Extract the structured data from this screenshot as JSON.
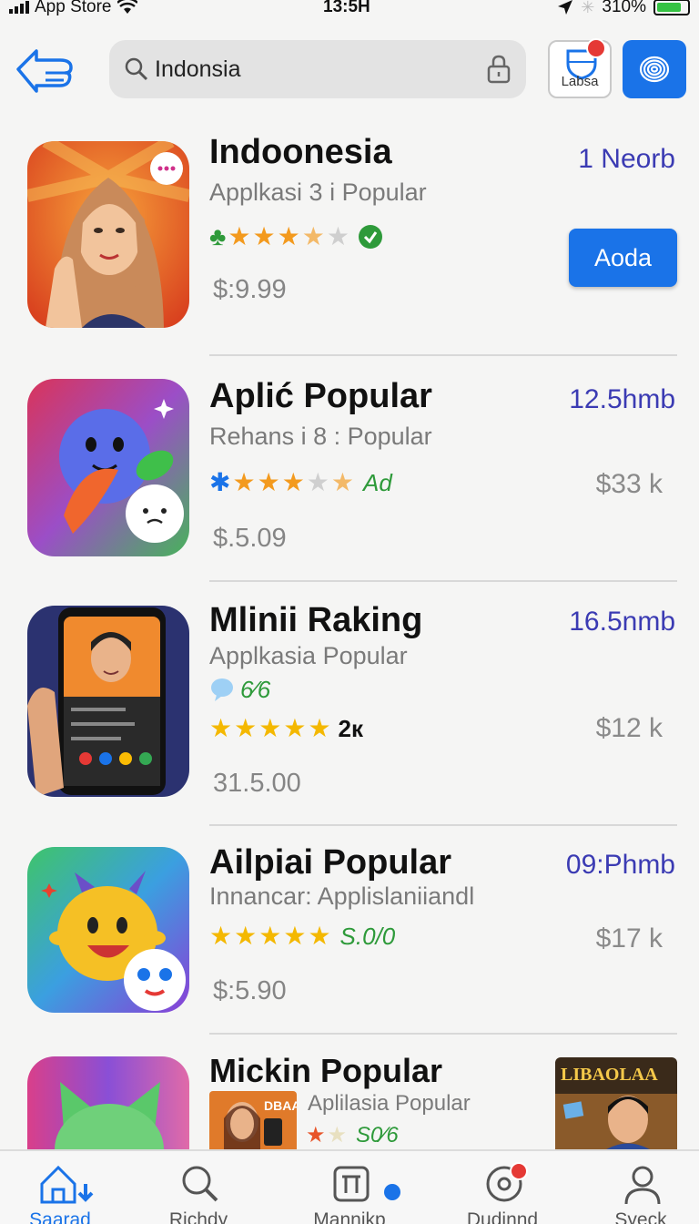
{
  "status": {
    "carrier": "App Store",
    "time": "13:5H",
    "battery": "310%"
  },
  "search": {
    "value": "Indonsia"
  },
  "labs_label": "Labsa",
  "apps": [
    {
      "title": "Indoonesia",
      "subtitle": "Applkasi 3 i Popular",
      "size": "1 Neorb",
      "price": "$:9.99",
      "button": "Aoda",
      "rating": 3.5
    },
    {
      "title": "Aplić Popular",
      "subtitle": "Rehans i 8 : Popular",
      "size": "12.5hmb",
      "badge": "Ad",
      "price": "$.5.09",
      "right_price": "$33 k",
      "rating": 3.5
    },
    {
      "title": "Mlinii Raking",
      "subtitle": "Applkasia Popular",
      "size": "16.5nmb",
      "extra": "6⁄6",
      "count": "2к",
      "price": "31.5.00",
      "right_price": "$12 k",
      "rating": 5
    },
    {
      "title": "Ailpiai Popular",
      "subtitle": "Innancar: Applislaniiandl",
      "size": "09:Phmb",
      "badge": "S.0/0",
      "price": "$:5.90",
      "right_price": "$17 k",
      "rating": 5
    },
    {
      "title": "Mickin Popular",
      "subtitle": "Aplilasia Popular",
      "badge": "S0⁄6",
      "thumb_text": "DBAA",
      "banner_text": "LIBAOLAA",
      "rating": 1.5
    }
  ],
  "tabs": [
    {
      "label": "Saarad"
    },
    {
      "label": "Richdy"
    },
    {
      "label": "Mannikp"
    },
    {
      "label": "Dudinnd"
    },
    {
      "label": "Syeck"
    }
  ],
  "colors": {
    "accent": "#1a73e8",
    "star": "#f39a1e",
    "size_text": "#3b3bb3",
    "badge_red": "#e53935"
  }
}
